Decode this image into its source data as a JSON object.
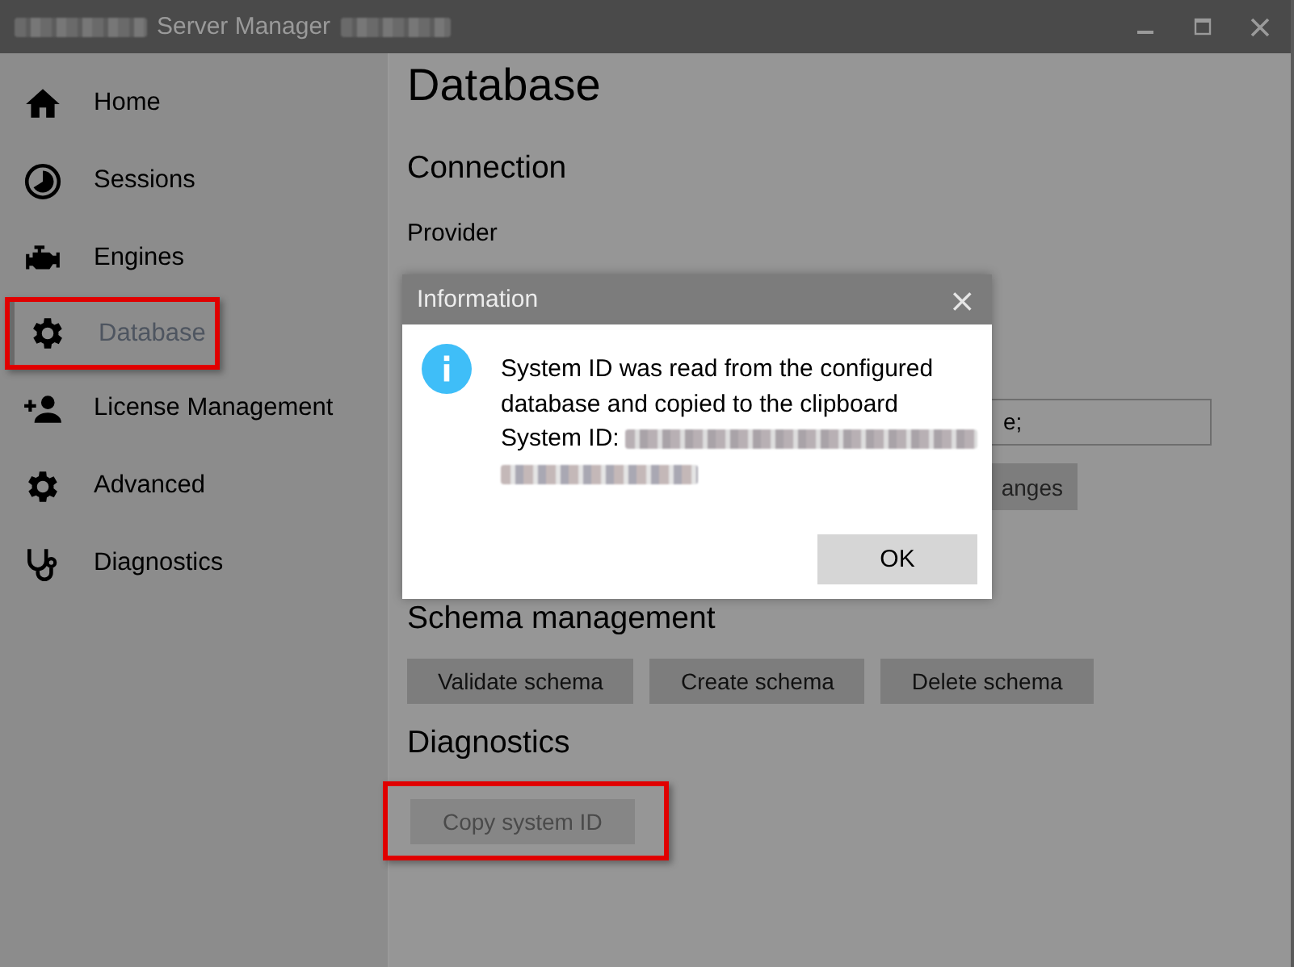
{
  "window": {
    "title": "Server Manager"
  },
  "sidebar": {
    "items": [
      {
        "label": "Home",
        "selected": false,
        "highlighted": false
      },
      {
        "label": "Sessions",
        "selected": false,
        "highlighted": false
      },
      {
        "label": "Engines",
        "selected": false,
        "highlighted": false
      },
      {
        "label": "Database",
        "selected": true,
        "highlighted": true
      },
      {
        "label": "License Management",
        "selected": false,
        "highlighted": false
      },
      {
        "label": "Advanced",
        "selected": false,
        "highlighted": false
      },
      {
        "label": "Diagnostics",
        "selected": false,
        "highlighted": false
      }
    ]
  },
  "page": {
    "title": "Database",
    "connection_heading": "Connection",
    "provider_label": "Provider",
    "connection_field": {
      "value": "e;"
    },
    "save_button": {
      "label": "anges"
    },
    "schema_heading": "Schema management",
    "schema_buttons": [
      {
        "label": "Validate schema",
        "disabled": false,
        "highlighted": false
      },
      {
        "label": "Create schema",
        "disabled": false,
        "highlighted": false
      },
      {
        "label": "Delete schema",
        "disabled": false,
        "highlighted": false
      }
    ],
    "diagnostics_heading": "Diagnostics",
    "diagnostics_buttons": [
      {
        "label": "Copy system ID",
        "disabled": true,
        "highlighted": true
      }
    ]
  },
  "dialog": {
    "title": "Information",
    "close": "×",
    "message": "System ID was read from the configured database and copied to the clipboard",
    "id_label": "System ID:",
    "button": "OK"
  }
}
